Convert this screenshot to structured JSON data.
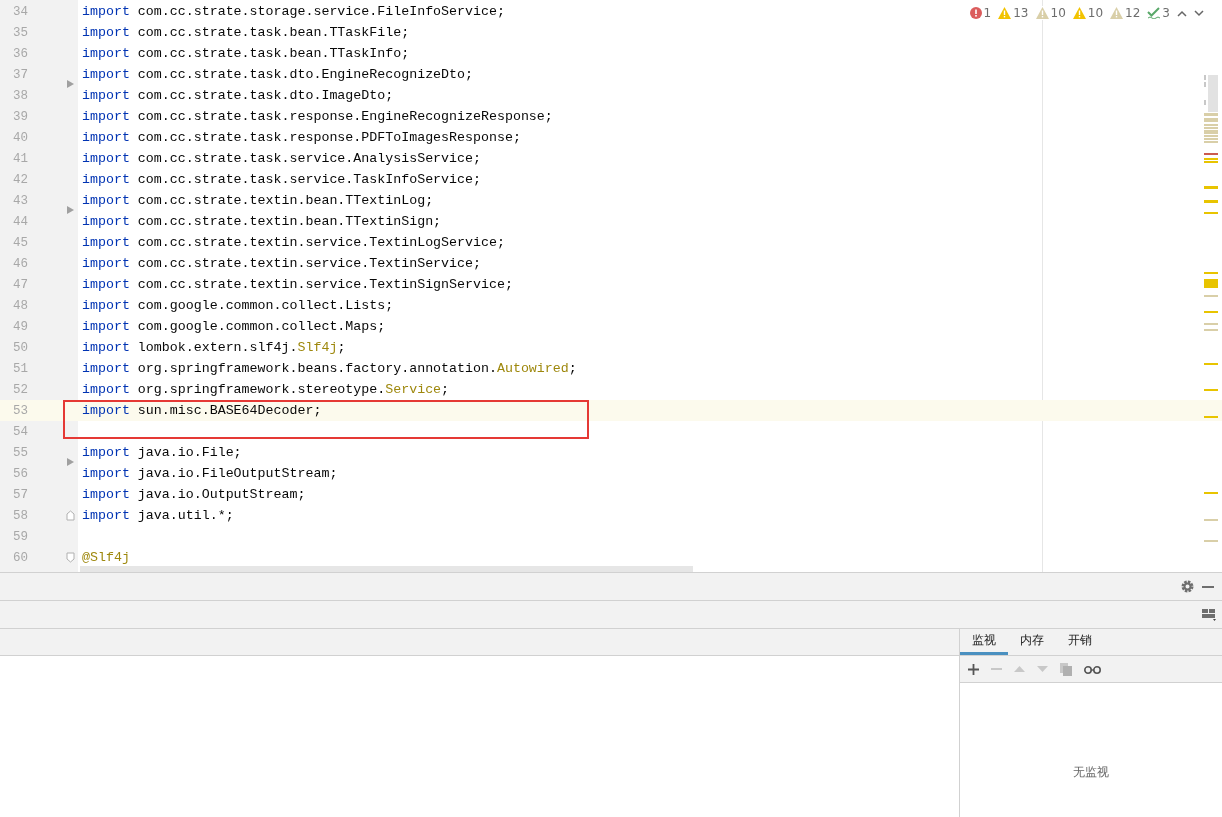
{
  "inspections": [
    {
      "kind": "error",
      "count": "1"
    },
    {
      "kind": "warning",
      "count": "13"
    },
    {
      "kind": "weak",
      "count": "10"
    },
    {
      "kind": "warning",
      "count": "10"
    },
    {
      "kind": "weak",
      "count": "12"
    },
    {
      "kind": "ok",
      "count": "3"
    }
  ],
  "lines": [
    {
      "number": "34",
      "parts": [
        {
          "kind": "keyword",
          "text": "import"
        },
        {
          "kind": "plain",
          "text": " com.cc.strate.storage.service.FileInfoService;"
        }
      ]
    },
    {
      "number": "35",
      "parts": [
        {
          "kind": "keyword",
          "text": "import"
        },
        {
          "kind": "plain",
          "text": " com.cc.strate.task.bean.TTaskFile;"
        }
      ]
    },
    {
      "number": "36",
      "parts": [
        {
          "kind": "keyword",
          "text": "import"
        },
        {
          "kind": "plain",
          "text": " com.cc.strate.task.bean.TTaskInfo;"
        }
      ]
    },
    {
      "number": "37",
      "parts": [
        {
          "kind": "keyword",
          "text": "import"
        },
        {
          "kind": "plain",
          "text": " com.cc.strate.task.dto.EngineRecognizeDto;"
        }
      ]
    },
    {
      "number": "38",
      "fold": {
        "kind": "arrow"
      },
      "parts": [
        {
          "kind": "keyword",
          "text": "import"
        },
        {
          "kind": "plain",
          "text": " com.cc.strate.task.dto.ImageDto;"
        }
      ]
    },
    {
      "number": "39",
      "parts": [
        {
          "kind": "keyword",
          "text": "import"
        },
        {
          "kind": "plain",
          "text": " com.cc.strate.task.response.EngineRecognizeResponse;"
        }
      ]
    },
    {
      "number": "40",
      "parts": [
        {
          "kind": "keyword",
          "text": "import"
        },
        {
          "kind": "plain",
          "text": " com.cc.strate.task.response.PDFToImagesResponse;"
        }
      ]
    },
    {
      "number": "41",
      "parts": [
        {
          "kind": "keyword",
          "text": "import"
        },
        {
          "kind": "plain",
          "text": " com.cc.strate.task.service.AnalysisService;"
        }
      ]
    },
    {
      "number": "42",
      "parts": [
        {
          "kind": "keyword",
          "text": "import"
        },
        {
          "kind": "plain",
          "text": " com.cc.strate.task.service.TaskInfoService;"
        }
      ]
    },
    {
      "number": "43",
      "parts": [
        {
          "kind": "keyword",
          "text": "import"
        },
        {
          "kind": "plain",
          "text": " com.cc.strate.textin.bean.TTextinLog;"
        }
      ]
    },
    {
      "number": "44",
      "fold": {
        "kind": "arrow"
      },
      "parts": [
        {
          "kind": "keyword",
          "text": "import"
        },
        {
          "kind": "plain",
          "text": " com.cc.strate.textin.bean.TTextinSign;"
        }
      ]
    },
    {
      "number": "45",
      "parts": [
        {
          "kind": "keyword",
          "text": "import"
        },
        {
          "kind": "plain",
          "text": " com.cc.strate.textin.service.TextinLogService;"
        }
      ]
    },
    {
      "number": "46",
      "parts": [
        {
          "kind": "keyword",
          "text": "import"
        },
        {
          "kind": "plain",
          "text": " com.cc.strate.textin.service.TextinService;"
        }
      ]
    },
    {
      "number": "47",
      "parts": [
        {
          "kind": "keyword",
          "text": "import"
        },
        {
          "kind": "plain",
          "text": " com.cc.strate.textin.service.TextinSignService;"
        }
      ]
    },
    {
      "number": "48",
      "parts": [
        {
          "kind": "keyword",
          "text": "import"
        },
        {
          "kind": "plain",
          "text": " com.google.common.collect.Lists;"
        }
      ]
    },
    {
      "number": "49",
      "parts": [
        {
          "kind": "keyword",
          "text": "import"
        },
        {
          "kind": "plain",
          "text": " com.google.common.collect.Maps;"
        }
      ]
    },
    {
      "number": "50",
      "parts": [
        {
          "kind": "keyword",
          "text": "import"
        },
        {
          "kind": "plain",
          "text": " lombok.extern.slf4j."
        },
        {
          "kind": "annotation",
          "text": "Slf4j"
        },
        {
          "kind": "plain",
          "text": ";"
        }
      ]
    },
    {
      "number": "51",
      "parts": [
        {
          "kind": "keyword",
          "text": "import"
        },
        {
          "kind": "plain",
          "text": " org.springframework.beans.factory.annotation."
        },
        {
          "kind": "annotation",
          "text": "Autowired"
        },
        {
          "kind": "plain",
          "text": ";"
        }
      ]
    },
    {
      "number": "52",
      "parts": [
        {
          "kind": "keyword",
          "text": "import"
        },
        {
          "kind": "plain",
          "text": " org.springframework.stereotype."
        },
        {
          "kind": "annotation",
          "text": "Service"
        },
        {
          "kind": "plain",
          "text": ";"
        }
      ]
    },
    {
      "number": "53",
      "current": true,
      "boxed": true,
      "parts": [
        {
          "kind": "keyword",
          "text": "import"
        },
        {
          "kind": "plain",
          "text": " sun.misc.BASE64Decoder;"
        }
      ]
    },
    {
      "number": "54"
    },
    {
      "number": "55",
      "parts": [
        {
          "kind": "keyword",
          "text": "import"
        },
        {
          "kind": "plain",
          "text": " java.io.File;"
        }
      ]
    },
    {
      "number": "56",
      "fold": {
        "kind": "arrow"
      },
      "parts": [
        {
          "kind": "keyword",
          "text": "import"
        },
        {
          "kind": "plain",
          "text": " java.io.FileOutputStream;"
        }
      ]
    },
    {
      "number": "57",
      "parts": [
        {
          "kind": "keyword",
          "text": "import"
        },
        {
          "kind": "plain",
          "text": " java.io.OutputStream;"
        }
      ]
    },
    {
      "number": "58",
      "fold": {
        "kind": "end"
      },
      "parts": [
        {
          "kind": "keyword",
          "text": "import"
        },
        {
          "kind": "plain",
          "text": " java.util.*;"
        }
      ]
    },
    {
      "number": "59"
    },
    {
      "number": "60",
      "fold": {
        "kind": "start"
      },
      "parts": [
        {
          "kind": "annotation",
          "text": "@Slf4j"
        }
      ]
    }
  ],
  "debug_panel": {
    "tabs": [
      {
        "label": "监视",
        "selected": true
      },
      {
        "label": "内存",
        "selected": false
      },
      {
        "label": "开销",
        "selected": false
      }
    ],
    "empty_text": "无监视"
  }
}
